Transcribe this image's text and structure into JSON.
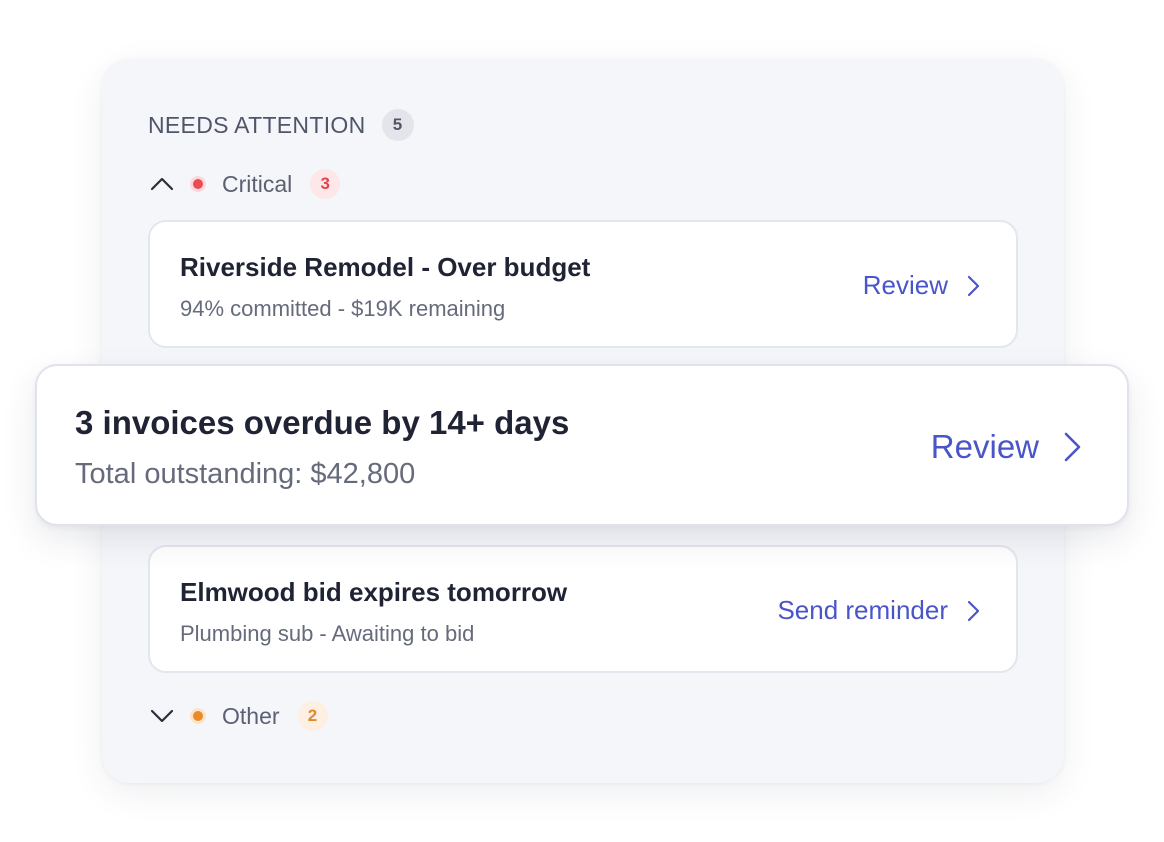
{
  "panel": {
    "title": "NEEDS ATTENTION",
    "count": "5"
  },
  "groups": {
    "critical": {
      "label": "Critical",
      "count": "3",
      "expanded": true,
      "dot_color": "#ea4b55",
      "chevron_icon": "chevron-up-icon"
    },
    "other": {
      "label": "Other",
      "count": "2",
      "expanded": false,
      "dot_color": "#ea8a2a",
      "chevron_icon": "chevron-down-icon"
    }
  },
  "items": [
    {
      "title": "Riverside Remodel - Over budget",
      "subtitle": "94% committed - $19K remaining",
      "action_label": "Review",
      "action_icon": "chevron-right-icon"
    },
    {
      "title": "3 invoices overdue by 14+ days",
      "subtitle": "Total outstanding: $42,800",
      "action_label": "Review",
      "action_icon": "chevron-right-icon"
    },
    {
      "title": "Elmwood bid expires tomorrow",
      "subtitle": "Plumbing sub - Awaiting to bid",
      "action_label": "Send reminder",
      "action_icon": "chevron-right-icon"
    }
  ],
  "colors": {
    "accent": "#4a55c9",
    "critical": "#e2434c",
    "other": "#e08a2e"
  }
}
